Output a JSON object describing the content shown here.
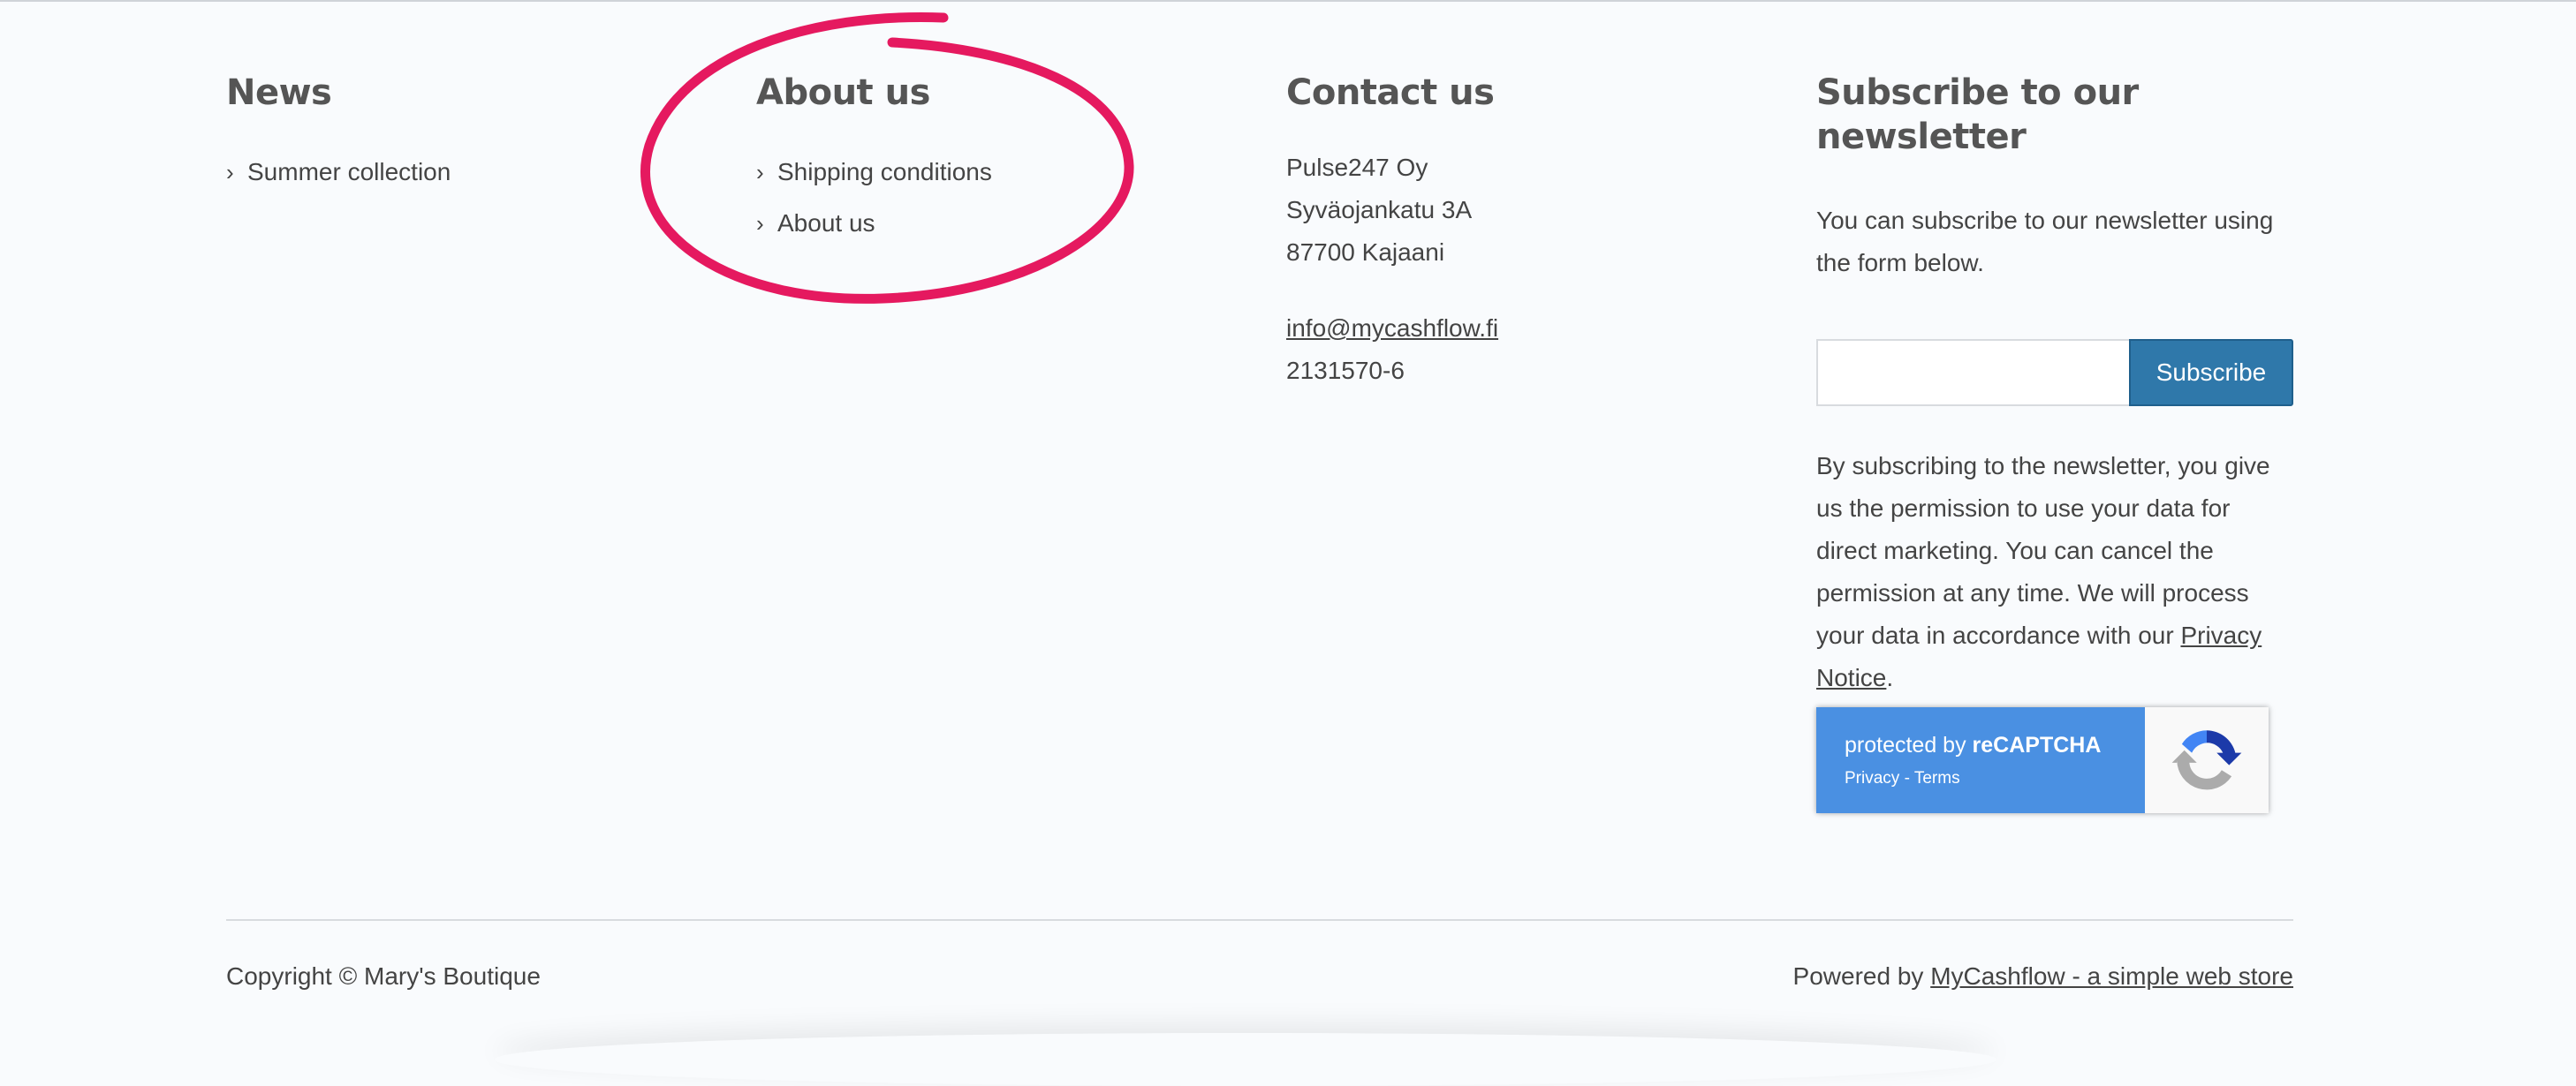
{
  "news": {
    "heading": "News",
    "links": [
      "Summer collection"
    ]
  },
  "about": {
    "heading": "About us",
    "links": [
      "Shipping conditions",
      "About us"
    ]
  },
  "contact": {
    "heading": "Contact us",
    "company": "Pulse247 Oy",
    "street": "Syväojankatu 3A",
    "city": "87700 Kajaani",
    "email": "info@mycashflow.fi",
    "business_id": "2131570-6"
  },
  "newsletter": {
    "heading": "Subscribe to our newsletter",
    "intro": "You can subscribe to our newsletter using the form below.",
    "email_value": "",
    "button_label": "Subscribe",
    "privacy_text": "By subscribing to the newsletter, you give us the permission to use your data for direct marketing. You can cancel the permission at any time. We will process your data in accordance with our ",
    "privacy_link": "Privacy Notice",
    "privacy_end": "."
  },
  "recaptcha": {
    "protected_prefix": "protected by ",
    "brand": "reCAPTCHA",
    "privacy": "Privacy",
    "separator": " - ",
    "terms": "Terms",
    "colors": {
      "panel": "#4a90e2"
    }
  },
  "footer": {
    "copyright": "Copyright © Mary's Boutique",
    "powered_prefix": "Powered by ",
    "powered_link": "MyCashflow - a simple web store"
  },
  "annotation": {
    "color": "#e5195f",
    "icon": "hand-drawn-circle"
  },
  "colors": {
    "accent": "#2f78aa",
    "text": "#444444",
    "heading": "#555555",
    "background": "#f9fbfd"
  }
}
